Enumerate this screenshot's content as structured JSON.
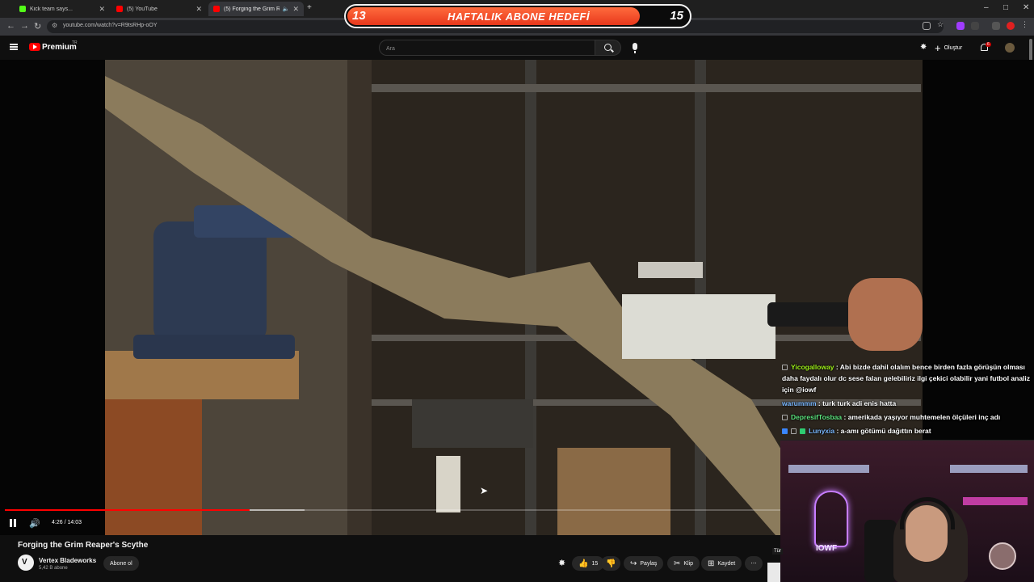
{
  "browser": {
    "tabs": [
      {
        "label": "Kick team says...",
        "favicon_color": "#53fc18"
      },
      {
        "label": "(5) YouTube",
        "favicon_color": "#ff0000"
      },
      {
        "label": "(5) Forging the Grim Reape",
        "favicon_color": "#ff0000",
        "active": true
      }
    ],
    "new_tab": "+",
    "url": "youtube.com/watch?v=R9tsRHp-oOY",
    "window_controls": [
      "–",
      "□",
      "✕"
    ]
  },
  "overlay": {
    "goal_left": "13",
    "goal_title": "HAFTALIK ABONE HEDEFİ",
    "goal_right": "15",
    "goal_progress": 0.85
  },
  "masthead": {
    "logo": "Premium",
    "country": "TR",
    "search_placeholder": "Ara",
    "create_label": "Oluştur",
    "notification_count": "6"
  },
  "player": {
    "time": "4:26 / 14:03",
    "played_fraction": 0.316,
    "buffered_fraction": 0.07
  },
  "chat": [
    {
      "user": "Yicogalloway",
      "user_color": "#9ef01a",
      "text": " : Abi bizde dahil olalım bence birden fazla görüşün olması daha faydalı olur dc sese falan gelebiliriz ilgi çekici olabilir yani futbol analiz için @iowf",
      "badges": [
        "outline"
      ]
    },
    {
      "user": "warummm",
      "user_color": "#7ab8ff",
      "text": " : turk turk adi enis hatta",
      "badges": []
    },
    {
      "user": "DepresifTosbaa",
      "user_color": "#5be37d",
      "text": " : amerikada yaşıyor muhtemelen ölçüleri inç adı",
      "badges": [
        "outline"
      ]
    },
    {
      "user": "Lunyxia",
      "user_color": "#7ab8ff",
      "text": " : a-amı götümü dağıttın berat",
      "badges": [
        "blue",
        "outline",
        "green"
      ]
    }
  ],
  "webcam": {
    "neon_text": "IOWF",
    "lang_tag": "Tür"
  },
  "video": {
    "title": "Forging the Grim Reaper's Scythe",
    "channel": "Vertex Bladeworks",
    "subscribers": "5,42 B abone",
    "subscribe_label": "Abone ol",
    "likes": "15",
    "share_label": "Paylaş",
    "clip_label": "Klip",
    "save_label": "Kaydet",
    "more_label": "⋯"
  },
  "icons": {
    "like": "👍",
    "dislike": "👎",
    "share": "↪",
    "clip": "✂",
    "save": "⊞",
    "volume": "🔊",
    "cursor": "➤"
  }
}
